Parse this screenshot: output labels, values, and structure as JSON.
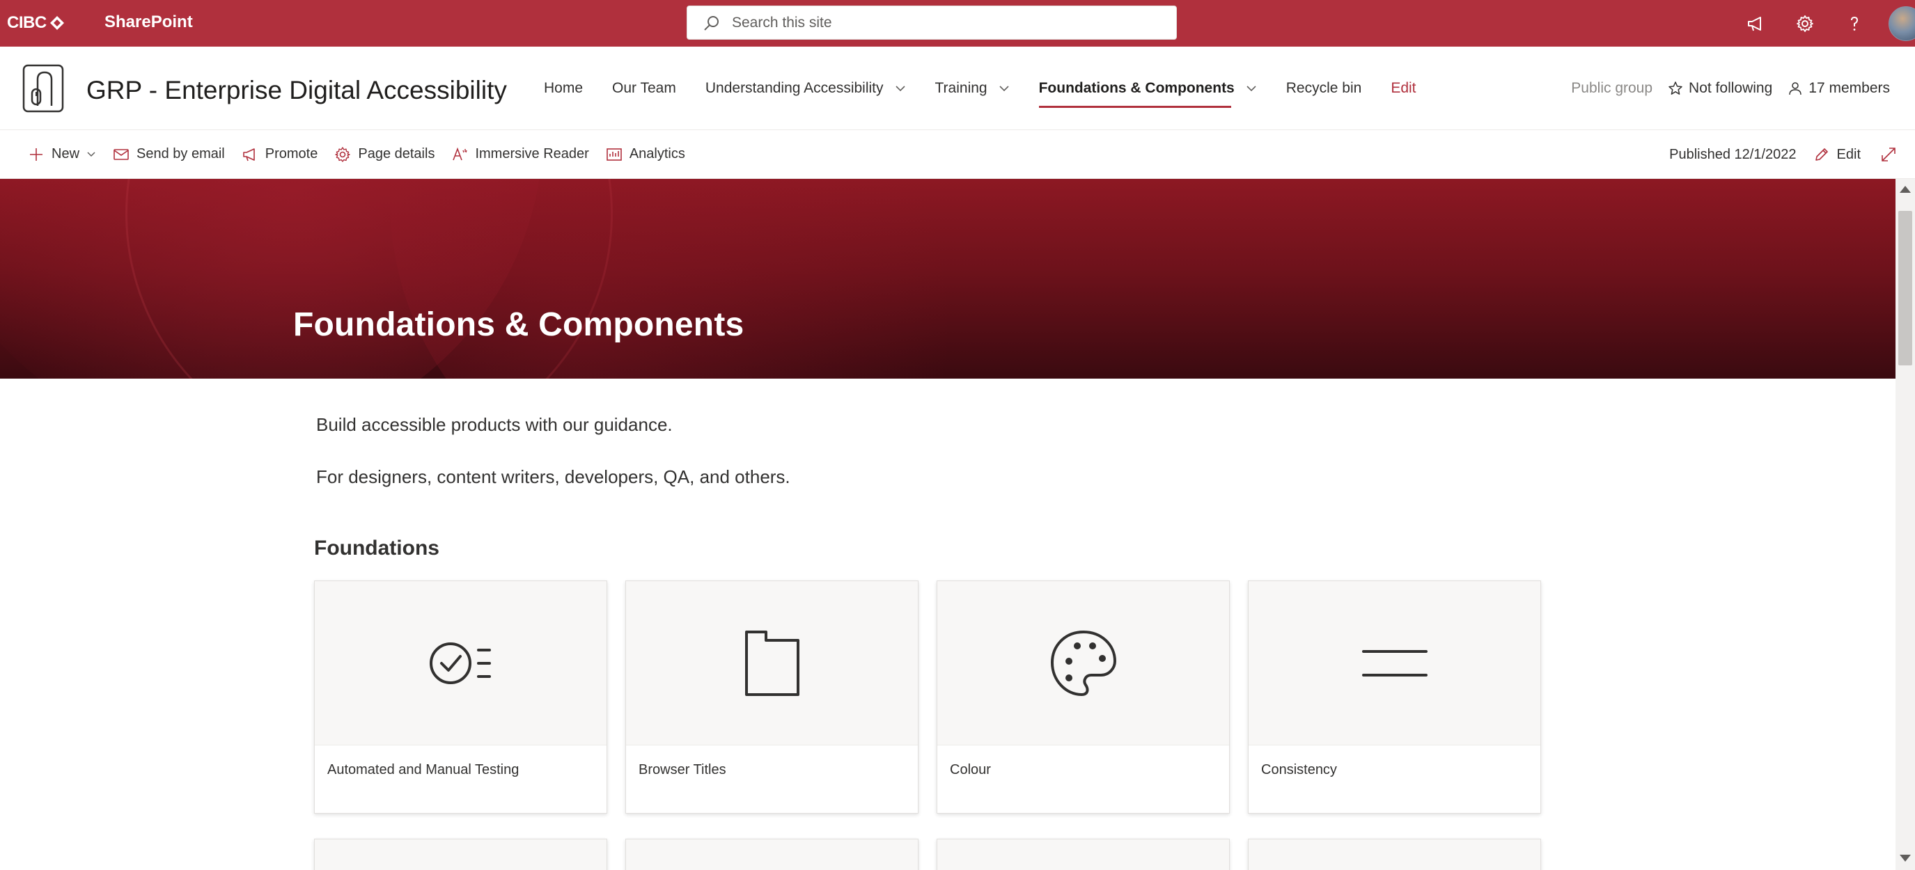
{
  "suite": {
    "brand": "CIBC",
    "app_name": "SharePoint",
    "search_placeholder": "Search this site",
    "accent_color": "#b0303d"
  },
  "site": {
    "title": "GRP - Enterprise Digital Accessibility",
    "nav": [
      {
        "label": "Home"
      },
      {
        "label": "Our Team"
      },
      {
        "label": "Understanding Accessibility"
      },
      {
        "label": "Training"
      },
      {
        "label": "Foundations & Components"
      },
      {
        "label": "Recycle bin"
      },
      {
        "label": "Edit"
      }
    ],
    "group_type": "Public group",
    "follow_label": "Not following",
    "members_label": "17 members"
  },
  "commandbar": {
    "new_label": "New",
    "send_email_label": "Send by email",
    "promote_label": "Promote",
    "page_details_label": "Page details",
    "immersive_reader_label": "Immersive Reader",
    "analytics_label": "Analytics",
    "published_label": "Published 12/1/2022",
    "edit_label": "Edit"
  },
  "hero": {
    "title": "Foundations & Components"
  },
  "content": {
    "intro_1": "Build accessible products with our guidance.",
    "intro_2": "For designers, content writers, developers, QA, and others.",
    "section_heading": "Foundations",
    "cards": [
      {
        "label": "Automated and Manual Testing",
        "icon": "checklist-icon"
      },
      {
        "label": "Browser Titles",
        "icon": "document-icon"
      },
      {
        "label": "Colour",
        "icon": "palette-icon"
      },
      {
        "label": "Consistency",
        "icon": "lines-icon"
      }
    ]
  }
}
